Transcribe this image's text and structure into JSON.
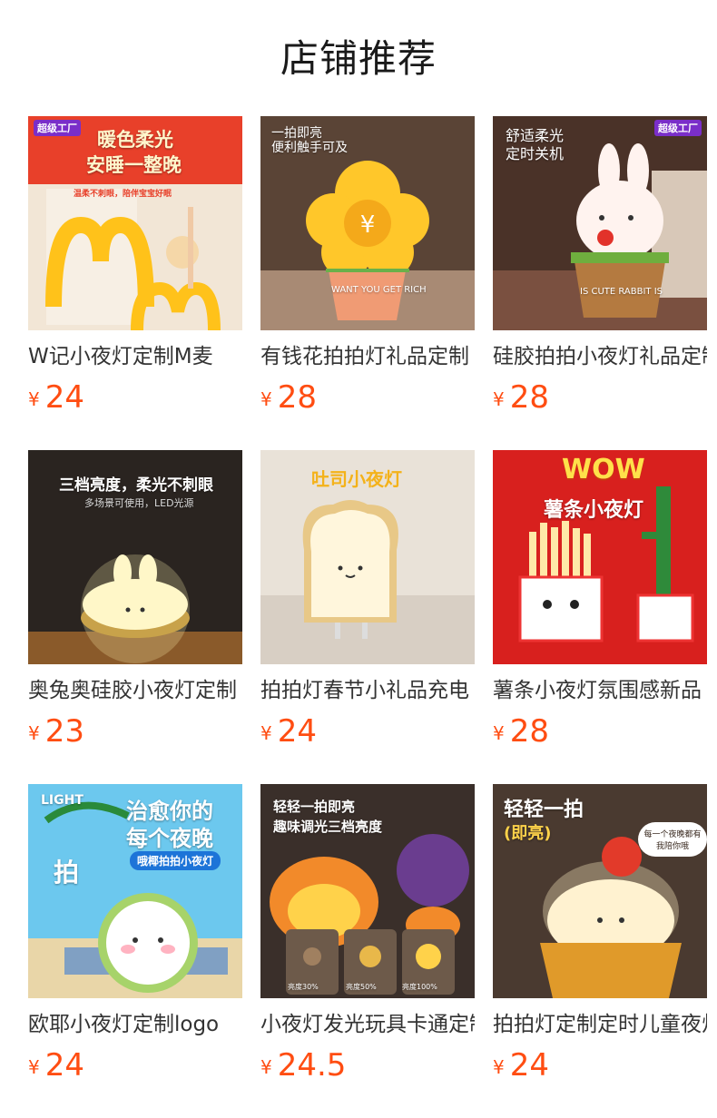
{
  "page": {
    "title": "店铺推荐"
  },
  "colors": {
    "price": "#ff4d12",
    "title": "#1a1a1a",
    "name": "#333333"
  },
  "currency": "¥",
  "products": [
    {
      "name": "W记小夜灯定制M麦",
      "price": "24",
      "image": {
        "icon": "m-arch-lamp-icon",
        "badge": "超级工厂",
        "headline": "暖色柔光",
        "headline2": "安睡一整晚",
        "caption": "温柔不刺眼，陪伴宝宝好眠"
      }
    },
    {
      "name": "有钱花拍拍灯礼品定制",
      "price": "28",
      "image": {
        "icon": "yuan-flower-lamp-icon",
        "headline": "一拍即亮",
        "headline2": "便利触手可及",
        "pot_text": "WANT YOU GET RICH"
      }
    },
    {
      "name": "硅胶拍拍小夜灯礼品定制",
      "price": "28",
      "image": {
        "icon": "rabbit-lamp-icon",
        "badge": "超级工厂",
        "headline": "舒适柔光",
        "headline2": "定时关机",
        "pot_text": "IS CUTE RABBIT IS"
      }
    },
    {
      "name": "奥兔奥硅胶小夜灯定制",
      "price": "23",
      "image": {
        "icon": "rabbit-burger-lamp-icon",
        "headline": "三档亮度，柔光不刺眼",
        "headline2": "多场景可使用，LED光源"
      }
    },
    {
      "name": "拍拍灯春节小礼品充电",
      "price": "24",
      "image": {
        "icon": "toast-lamp-icon",
        "headline": "吐司小夜灯"
      }
    },
    {
      "name": "薯条小夜灯氛围感新品",
      "price": "28",
      "image": {
        "icon": "fries-lamp-icon",
        "headline": "WOW",
        "headline2": "薯条小夜灯"
      }
    },
    {
      "name": "欧耶小夜灯定制logo",
      "price": "24",
      "image": {
        "icon": "coconut-lamp-icon",
        "headline": "LIGHT",
        "headline2": "治愈你的",
        "headline3": "每个夜晚",
        "tag": "哦椰拍拍小夜灯",
        "side": "拍"
      }
    },
    {
      "name": "小夜灯发光玩具卡通定制",
      "price": "24.5",
      "image": {
        "icon": "mushroom-lamp-icon",
        "headline": "轻轻一拍即亮",
        "headline2": "趣味调光三档亮度",
        "levels": [
          "亮度30%",
          "亮度50%",
          "亮度100%"
        ]
      }
    },
    {
      "name": "拍拍灯定制定时儿童夜灯",
      "price": "24",
      "image": {
        "icon": "cake-lamp-icon",
        "headline": "轻轻一拍",
        "headline2": "(即亮)",
        "note": "每一个夜晚都有我陪你哦"
      }
    }
  ]
}
